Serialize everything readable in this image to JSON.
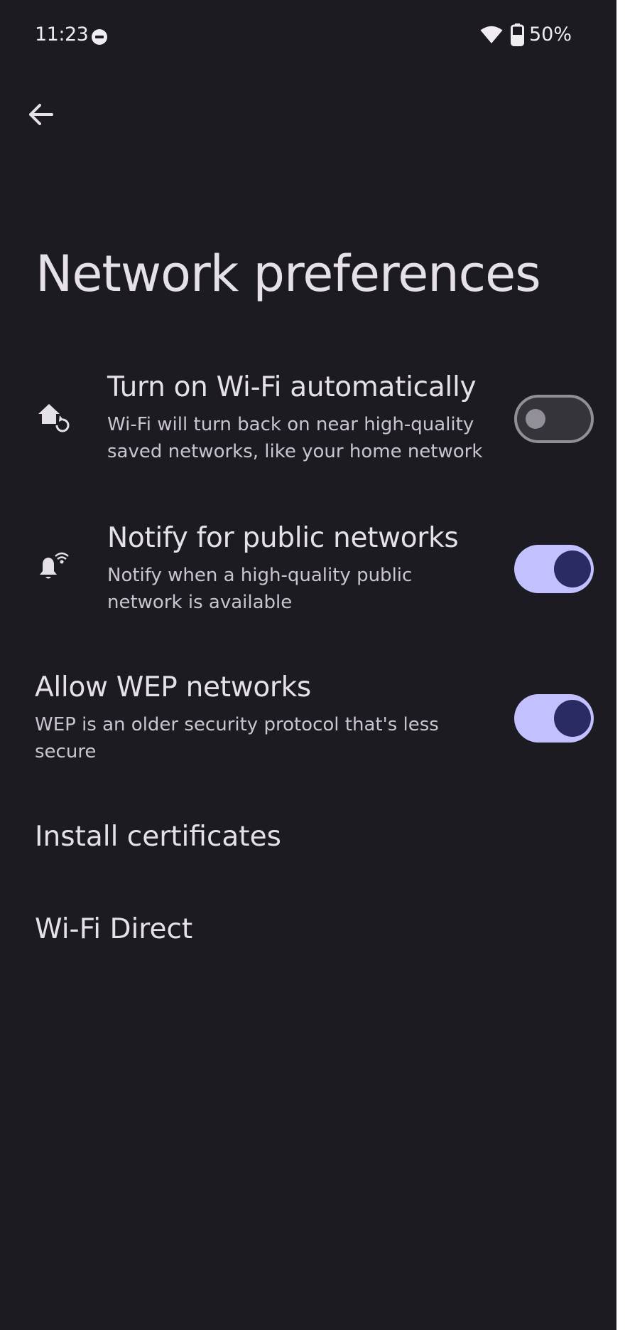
{
  "status_bar": {
    "time": "11:23",
    "battery": "50%"
  },
  "header": {
    "back_icon": "arrow-back-icon",
    "title": "Network preferences"
  },
  "preferences": [
    {
      "title": "Turn on Wi‑Fi automatically",
      "summary": "Wi‑Fi will turn back on near high‑quality saved networks, like your home network",
      "icon": "wifi-auto-home-icon",
      "enabled": false
    },
    {
      "title": "Notify for public networks",
      "summary": "Notify when a high‑quality public network is available",
      "icon": "notification-wifi-icon",
      "enabled": true
    },
    {
      "title": "Allow WEP networks",
      "summary": "WEP is an older security protocol that's less secure",
      "enabled": true
    }
  ],
  "links": [
    {
      "title": "Install certificates"
    },
    {
      "title": "Wi‑Fi Direct"
    }
  ],
  "colors": {
    "background": "#1c1b21",
    "switch_on_track": "#c3c0ff",
    "switch_on_thumb": "#2a2b62",
    "switch_off_outline": "#938f99"
  }
}
